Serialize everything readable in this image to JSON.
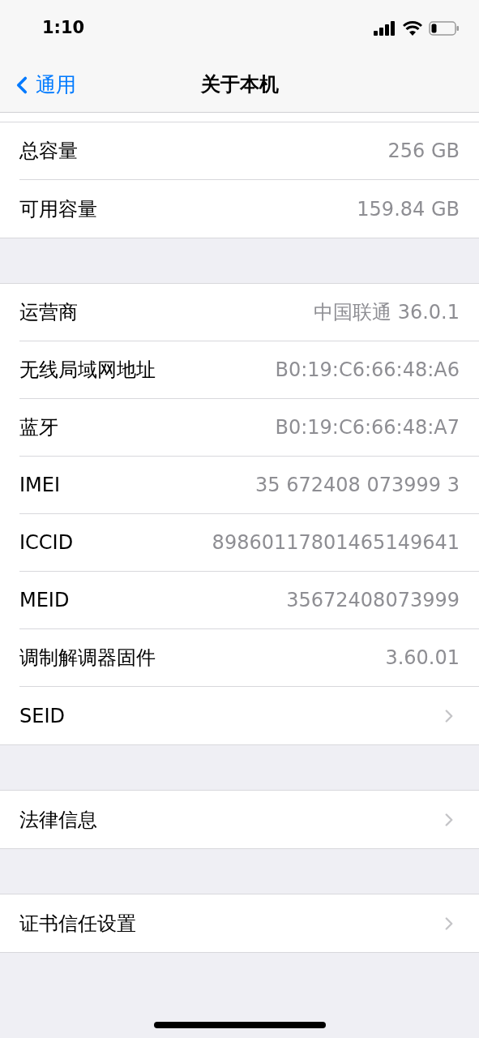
{
  "status_bar": {
    "time": "1:10"
  },
  "nav": {
    "back": "通用",
    "title": "关于本机"
  },
  "sections": [
    {
      "rows": [
        {
          "kind": "value",
          "label": "总容量",
          "value": "256 GB"
        },
        {
          "kind": "value",
          "label": "可用容量",
          "value": "159.84 GB"
        }
      ]
    },
    {
      "rows": [
        {
          "kind": "value",
          "label": "运营商",
          "value": "中国联通 36.0.1"
        },
        {
          "kind": "value",
          "label": "无线局域网地址",
          "value": "B0:19:C6:66:48:A6"
        },
        {
          "kind": "value",
          "label": "蓝牙",
          "value": "B0:19:C6:66:48:A7"
        },
        {
          "kind": "value",
          "label": "IMEI",
          "value": "35 672408 073999 3"
        },
        {
          "kind": "value",
          "label": "ICCID",
          "value": "89860117801465149641"
        },
        {
          "kind": "value",
          "label": "MEID",
          "value": "35672408073999"
        },
        {
          "kind": "value",
          "label": "调制解调器固件",
          "value": "3.60.01"
        },
        {
          "kind": "link",
          "label": "SEID"
        }
      ]
    },
    {
      "rows": [
        {
          "kind": "link",
          "label": "法律信息"
        }
      ]
    },
    {
      "rows": [
        {
          "kind": "link",
          "label": "证书信任设置"
        }
      ]
    }
  ]
}
